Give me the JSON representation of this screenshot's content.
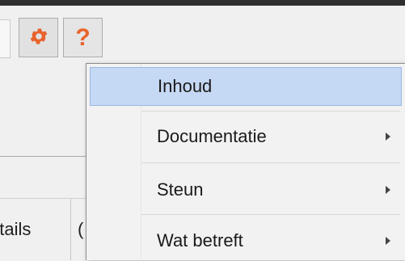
{
  "toolbar": {
    "settings_icon": "gear-icon",
    "help_icon": "question-mark-icon",
    "help_symbol": "?",
    "accent": "#e8632b"
  },
  "tabs": {
    "details_label": "etails",
    "next_label": "("
  },
  "help_menu": {
    "highlight_color": "#c6d9f4",
    "items": [
      {
        "label": "Inhoud",
        "has_submenu": false
      },
      {
        "label": "Documentatie",
        "has_submenu": true
      },
      {
        "label": "Steun",
        "has_submenu": true
      },
      {
        "label": "Wat betreft",
        "has_submenu": true
      }
    ]
  }
}
